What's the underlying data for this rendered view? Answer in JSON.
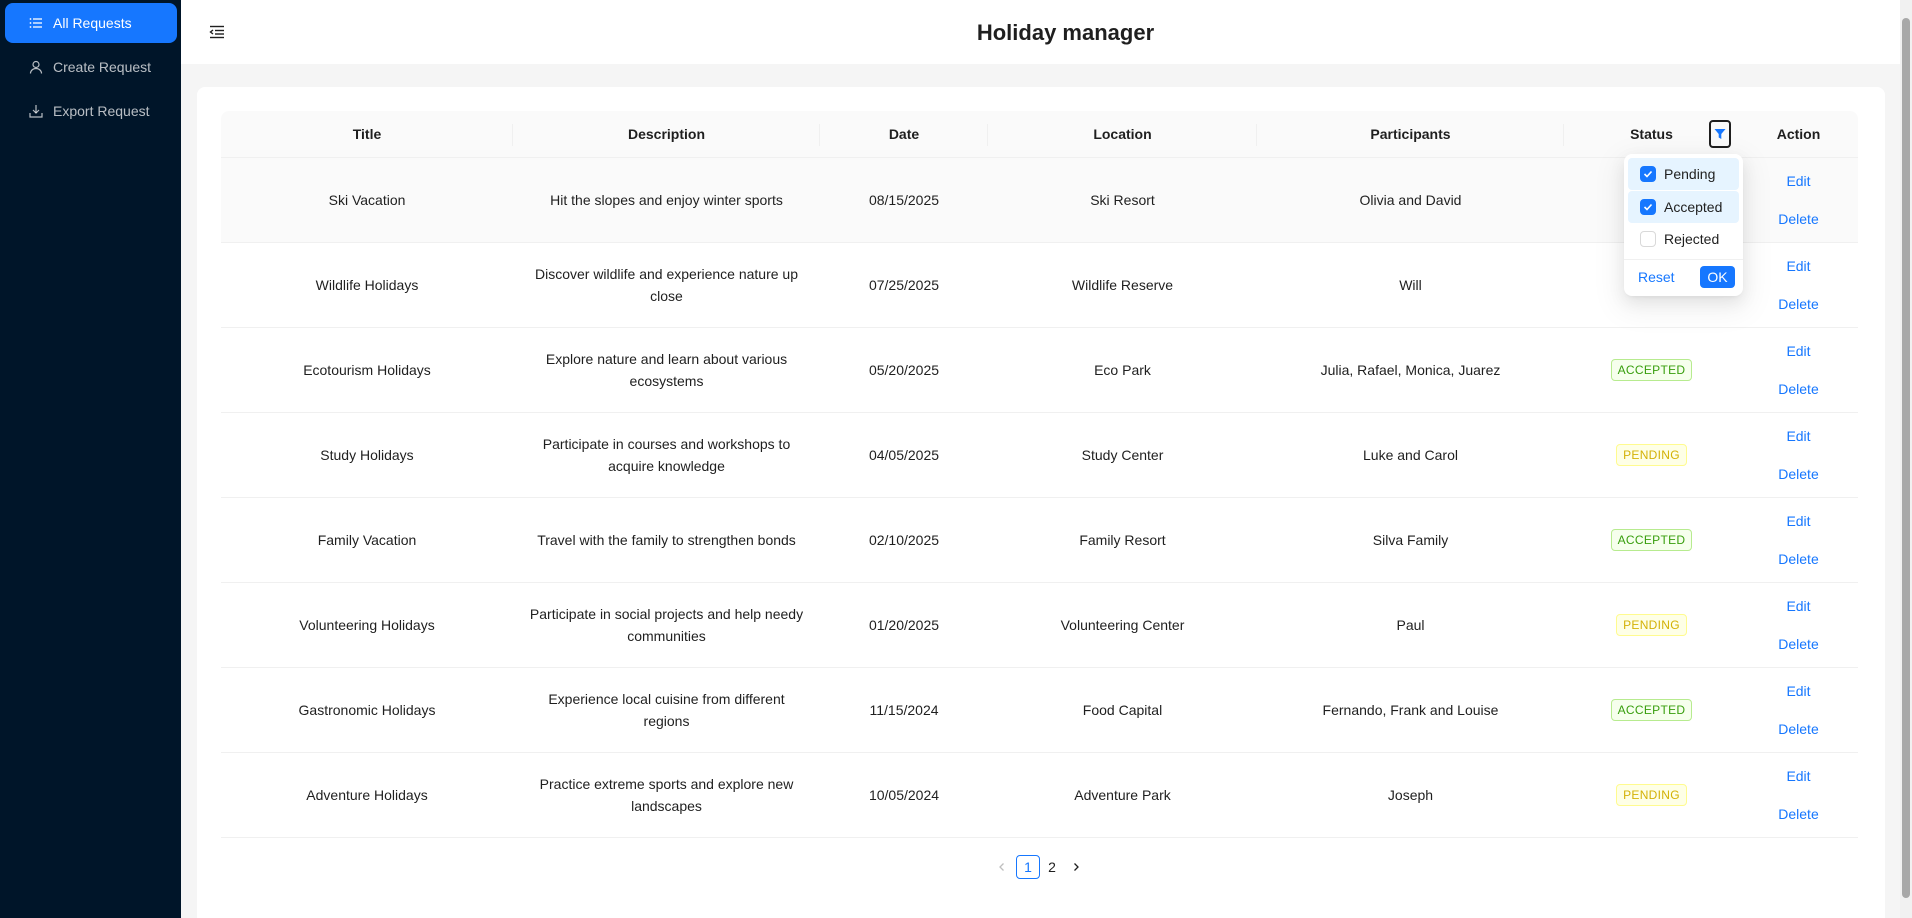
{
  "app": {
    "title": "Holiday manager"
  },
  "sidebar": {
    "items": [
      {
        "label": "All Requests",
        "icon": "list-icon",
        "active": true
      },
      {
        "label": "Create Request",
        "icon": "user-icon",
        "active": false
      },
      {
        "label": "Export Request",
        "icon": "export-icon",
        "active": false
      }
    ]
  },
  "table": {
    "columns": [
      "Title",
      "Description",
      "Date",
      "Location",
      "Participants",
      "Status",
      "Action"
    ],
    "rows": [
      {
        "title": "Ski Vacation",
        "description": "Hit the slopes and enjoy winter sports",
        "date": "08/15/2025",
        "location": "Ski Resort",
        "participants": "Olivia and David",
        "status": "",
        "status_type": "hidden"
      },
      {
        "title": "Wildlife Holidays",
        "description": "Discover wildlife and experience nature up close",
        "date": "07/25/2025",
        "location": "Wildlife Reserve",
        "participants": "Will",
        "status": "",
        "status_type": "hidden"
      },
      {
        "title": "Ecotourism Holidays",
        "description": "Explore nature and learn about various ecosystems",
        "date": "05/20/2025",
        "location": "Eco Park",
        "participants": "Julia, Rafael, Monica, Juarez",
        "status": "ACCEPTED",
        "status_type": "accepted"
      },
      {
        "title": "Study Holidays",
        "description": "Participate in courses and workshops to acquire knowledge",
        "date": "04/05/2025",
        "location": "Study Center",
        "participants": "Luke and Carol",
        "status": "PENDING",
        "status_type": "pending"
      },
      {
        "title": "Family Vacation",
        "description": "Travel with the family to strengthen bonds",
        "date": "02/10/2025",
        "location": "Family Resort",
        "participants": "Silva Family",
        "status": "ACCEPTED",
        "status_type": "accepted"
      },
      {
        "title": "Volunteering Holidays",
        "description": "Participate in social projects and help needy communities",
        "date": "01/20/2025",
        "location": "Volunteering Center",
        "participants": "Paul",
        "status": "PENDING",
        "status_type": "pending"
      },
      {
        "title": "Gastronomic Holidays",
        "description": "Experience local cuisine from different regions",
        "date": "11/15/2024",
        "location": "Food Capital",
        "participants": "Fernando, Frank and Louise",
        "status": "ACCEPTED",
        "status_type": "accepted"
      },
      {
        "title": "Adventure Holidays",
        "description": "Practice extreme sports and explore new landscapes",
        "date": "10/05/2024",
        "location": "Adventure Park",
        "participants": "Joseph",
        "status": "PENDING",
        "status_type": "pending"
      }
    ],
    "actions": {
      "edit": "Edit",
      "delete": "Delete"
    }
  },
  "filter": {
    "options": [
      {
        "label": "Pending",
        "checked": true
      },
      {
        "label": "Accepted",
        "checked": true
      },
      {
        "label": "Rejected",
        "checked": false
      }
    ],
    "reset_label": "Reset",
    "ok_label": "OK"
  },
  "pagination": {
    "pages": [
      "1",
      "2"
    ],
    "current": "1"
  },
  "colors": {
    "primary": "#1677ff",
    "sidebar_bg": "#001529",
    "accepted": "#389e0d",
    "pending": "#d4b106"
  }
}
